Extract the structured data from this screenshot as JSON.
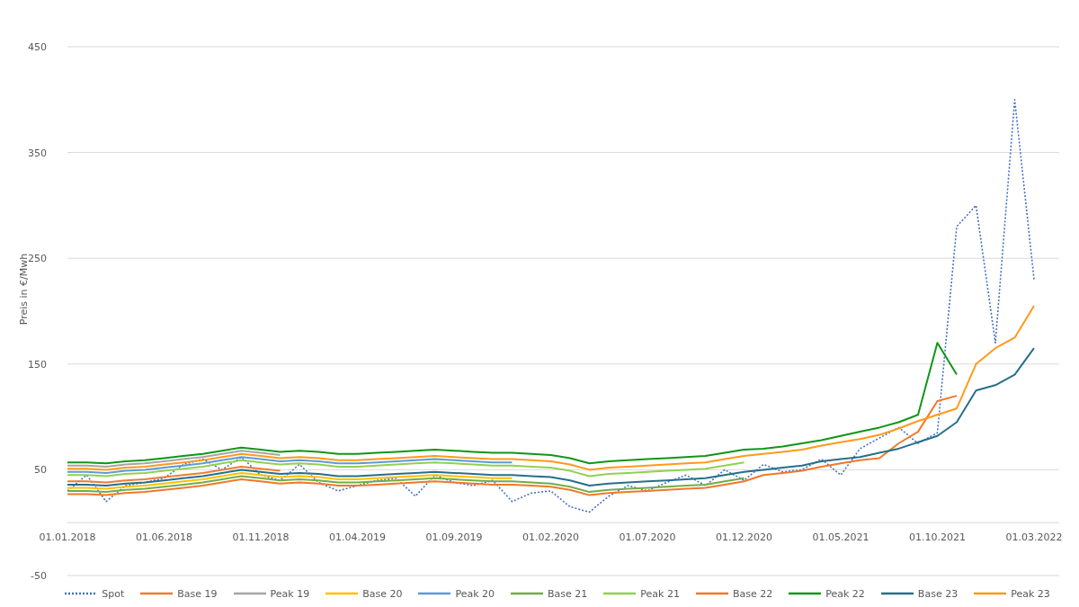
{
  "chart": {
    "chart_data": {
      "type": "line",
      "ylabel": "Preis in €/Mwh",
      "grid": true,
      "legend": true,
      "categories": [
        "01.01.2018",
        null,
        null,
        null,
        null,
        "01.06.2018",
        null,
        null,
        null,
        null,
        "01.11.2018",
        null,
        null,
        null,
        null,
        "01.04.2019",
        null,
        null,
        null,
        null,
        "01.09.2019",
        null,
        null,
        null,
        null,
        "01.02.2020",
        null,
        null,
        null,
        null,
        "01.07.2020",
        null,
        null,
        null,
        null,
        "01.12.2020",
        null,
        null,
        null,
        null,
        "01.05.2021",
        null,
        null,
        null,
        null,
        "01.10.2021",
        null,
        null,
        null,
        null,
        "01.03.2022"
      ],
      "ylim": [
        -50,
        450
      ],
      "yticks": [
        -50,
        50,
        150,
        250,
        350,
        450
      ],
      "series": [
        {
          "name": "Spot",
          "color": "#4472c4",
          "line_style": "dotted",
          "values": [
            30,
            45,
            20,
            35,
            38,
            42,
            55,
            60,
            50,
            62,
            45,
            40,
            55,
            38,
            30,
            35,
            40,
            42,
            25,
            45,
            38,
            35,
            40,
            20,
            28,
            30,
            15,
            10,
            25,
            35,
            30,
            38,
            45,
            35,
            50,
            40,
            55,
            48,
            50,
            60,
            45,
            70,
            80,
            90,
            75,
            85,
            280,
            300,
            170,
            400,
            230
          ]
        },
        {
          "name": "Base 19",
          "color": "#ed7d31",
          "line_style": "solid",
          "values": [
            39,
            39,
            38,
            40,
            41,
            43,
            45,
            47,
            50,
            53,
            51,
            49,
            null,
            null,
            null,
            null,
            null,
            null,
            null,
            null,
            null,
            null,
            null,
            null,
            null,
            null,
            null,
            null,
            null,
            null,
            null,
            null,
            null,
            null,
            null,
            null,
            null,
            null,
            null,
            null,
            null,
            null,
            null,
            null,
            null,
            null,
            null,
            null,
            null,
            null,
            null
          ]
        },
        {
          "name": "Peak 19",
          "color": "#a5a5a5",
          "line_style": "solid",
          "values": [
            54,
            54,
            53,
            55,
            56,
            58,
            60,
            62,
            65,
            68,
            66,
            64,
            null,
            null,
            null,
            null,
            null,
            null,
            null,
            null,
            null,
            null,
            null,
            null,
            null,
            null,
            null,
            null,
            null,
            null,
            null,
            null,
            null,
            null,
            null,
            null,
            null,
            null,
            null,
            null,
            null,
            null,
            null,
            null,
            null,
            null,
            null,
            null,
            null,
            null,
            null
          ]
        },
        {
          "name": "Base 20",
          "color": "#ffc000",
          "line_style": "solid",
          "values": [
            33,
            33,
            32,
            34,
            35,
            37,
            39,
            41,
            44,
            47,
            45,
            43,
            44,
            43,
            41,
            41,
            42,
            43,
            44,
            45,
            44,
            43,
            42,
            42,
            null,
            null,
            null,
            null,
            null,
            null,
            null,
            null,
            null,
            null,
            null,
            null,
            null,
            null,
            null,
            null,
            null,
            null,
            null,
            null,
            null,
            null,
            null,
            null,
            null,
            null,
            null
          ]
        },
        {
          "name": "Peak 20",
          "color": "#5b9bd5",
          "line_style": "solid",
          "values": [
            48,
            48,
            47,
            49,
            50,
            52,
            54,
            56,
            59,
            62,
            60,
            58,
            59,
            58,
            56,
            56,
            57,
            58,
            59,
            60,
            59,
            58,
            57,
            57,
            null,
            null,
            null,
            null,
            null,
            null,
            null,
            null,
            null,
            null,
            null,
            null,
            null,
            null,
            null,
            null,
            null,
            null,
            null,
            null,
            null,
            null,
            null,
            null,
            null,
            null,
            null
          ]
        },
        {
          "name": "Base 21",
          "color": "#70ad47",
          "line_style": "solid",
          "values": [
            30,
            30,
            29,
            31,
            32,
            34,
            36,
            38,
            41,
            44,
            42,
            40,
            41,
            40,
            38,
            38,
            39,
            40,
            41,
            42,
            41,
            40,
            39,
            39,
            38,
            37,
            34,
            29,
            31,
            32,
            33,
            34,
            35,
            36,
            39,
            42,
            null,
            null,
            null,
            null,
            null,
            null,
            null,
            null,
            null,
            null,
            null,
            null,
            null,
            null,
            null
          ]
        },
        {
          "name": "Peak 21",
          "color": "#92d050",
          "line_style": "solid",
          "values": [
            45,
            45,
            44,
            46,
            47,
            49,
            51,
            53,
            56,
            59,
            57,
            55,
            56,
            55,
            53,
            53,
            54,
            55,
            56,
            57,
            56,
            55,
            54,
            54,
            53,
            52,
            49,
            44,
            46,
            47,
            48,
            49,
            50,
            51,
            54,
            57,
            null,
            null,
            null,
            null,
            null,
            null,
            null,
            null,
            null,
            null,
            null,
            null,
            null,
            null,
            null
          ]
        },
        {
          "name": "Base 22",
          "color": "#f0782a",
          "line_style": "solid",
          "values": [
            27,
            27,
            26,
            28,
            29,
            31,
            33,
            35,
            38,
            41,
            39,
            37,
            38,
            37,
            35,
            35,
            36,
            37,
            38,
            39,
            38,
            37,
            36,
            36,
            35,
            34,
            31,
            26,
            28,
            29,
            30,
            31,
            32,
            33,
            36,
            39,
            45,
            47,
            49,
            53,
            56,
            59,
            61,
            75,
            86,
            115,
            120,
            null,
            null,
            null,
            null
          ]
        },
        {
          "name": "Peak 22",
          "color": "#109618",
          "line_style": "solid",
          "values": [
            57,
            57,
            56,
            58,
            59,
            61,
            63,
            65,
            68,
            71,
            69,
            67,
            68,
            67,
            65,
            65,
            66,
            67,
            68,
            69,
            68,
            67,
            66,
            66,
            65,
            64,
            61,
            56,
            58,
            59,
            60,
            61,
            62,
            63,
            66,
            69,
            70,
            72,
            75,
            78,
            82,
            86,
            90,
            95,
            102,
            170,
            140,
            null,
            null,
            null,
            null
          ]
        },
        {
          "name": "Base 23",
          "color": "#266f8a",
          "line_style": "solid",
          "values": [
            36,
            36,
            35,
            37,
            38,
            40,
            42,
            44,
            47,
            50,
            48,
            46,
            47,
            46,
            44,
            44,
            45,
            46,
            47,
            48,
            47,
            46,
            45,
            45,
            44,
            43,
            40,
            35,
            37,
            38,
            39,
            40,
            41,
            42,
            45,
            48,
            50,
            52,
            54,
            58,
            60,
            62,
            66,
            70,
            76,
            82,
            95,
            125,
            130,
            140,
            165
          ]
        },
        {
          "name": "Peak 23",
          "color": "#ff9a1a",
          "line_style": "solid",
          "values": [
            51,
            51,
            50,
            52,
            53,
            55,
            57,
            59,
            62,
            65,
            63,
            61,
            62,
            61,
            59,
            59,
            60,
            61,
            62,
            63,
            62,
            61,
            60,
            60,
            59,
            58,
            55,
            50,
            52,
            53,
            54,
            55,
            56,
            57,
            60,
            63,
            65,
            67,
            69,
            73,
            76,
            79,
            83,
            89,
            96,
            102,
            108,
            150,
            165,
            175,
            205
          ]
        }
      ]
    }
  }
}
